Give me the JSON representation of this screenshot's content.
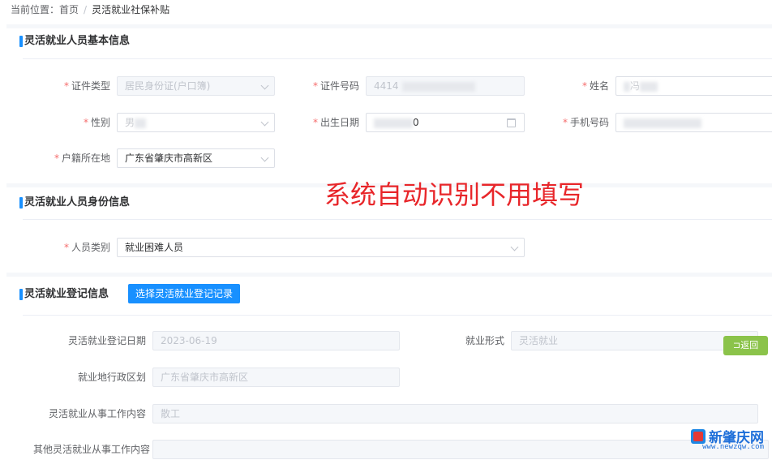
{
  "breadcrumb": {
    "prefix": "当前位置：",
    "home": "首页",
    "separator": "/",
    "current": "灵活就业社保补贴"
  },
  "sections": {
    "basic": {
      "title": "灵活就业人员基本信息"
    },
    "identity": {
      "title": "灵活就业人员身份信息"
    },
    "registration": {
      "title": "灵活就业登记信息",
      "select_button": "选择灵活就业登记记录"
    }
  },
  "fields": {
    "id_type": {
      "label": "证件类型",
      "value": "居民身份证(户口簿)"
    },
    "id_number": {
      "label": "证件号码",
      "value": "4414"
    },
    "name": {
      "label": "姓名",
      "value": "冯"
    },
    "gender": {
      "label": "性别",
      "value": "男"
    },
    "birth_date": {
      "label": "出生日期",
      "value": "0"
    },
    "phone": {
      "label": "手机号码",
      "value": ""
    },
    "household": {
      "label": "户籍所在地",
      "value": "广东省肇庆市高新区"
    },
    "person_type": {
      "label": "人员类别",
      "value": "就业困难人员"
    },
    "reg_date": {
      "label": "灵活就业登记日期",
      "value": "2023-06-19"
    },
    "employment_form": {
      "label": "就业形式",
      "value": "灵活就业"
    },
    "admin_region": {
      "label": "就业地行政区划",
      "value": "广东省肇庆市高新区"
    },
    "work_content": {
      "label": "灵活就业从事工作内容",
      "value": "散工"
    },
    "other_work": {
      "label": "其他灵活就业从事工作内容",
      "value": ""
    }
  },
  "required_mark": "*",
  "overlay_note": "系统自动识别不用填写",
  "back_button": "返回",
  "watermark": {
    "name": "新肇庆网",
    "url": "www.newzqw.com"
  },
  "colors": {
    "accent": "#1890ff",
    "required": "#f56c6c",
    "overlay": "#e8262a",
    "back": "#8bc34a"
  }
}
